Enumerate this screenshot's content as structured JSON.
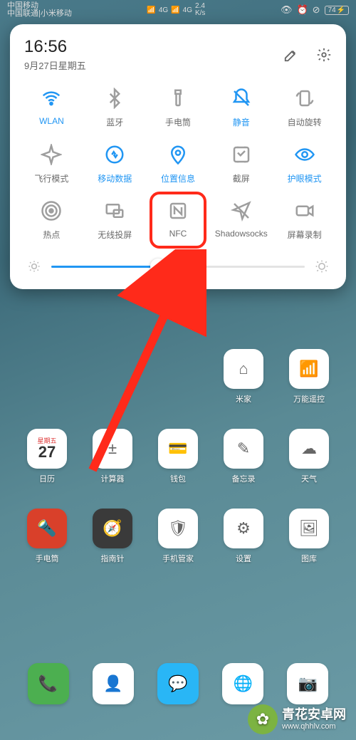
{
  "status": {
    "carrier1": "中国移动",
    "carrier2": "中国联通|小米移动",
    "net1": "4G",
    "net2": "4G",
    "speed": "2.4\nK/s",
    "battery": "74"
  },
  "panel": {
    "time": "16:56",
    "date": "9月27日星期五"
  },
  "tiles": [
    {
      "key": "wlan",
      "label": "WLAN",
      "state": "on"
    },
    {
      "key": "bluetooth",
      "label": "蓝牙",
      "state": "off"
    },
    {
      "key": "flashlight",
      "label": "手电筒",
      "state": "off"
    },
    {
      "key": "mute",
      "label": "静音",
      "state": "on"
    },
    {
      "key": "autorotate",
      "label": "自动旋转",
      "state": "off"
    },
    {
      "key": "airplane",
      "label": "飞行模式",
      "state": "off"
    },
    {
      "key": "data",
      "label": "移动数据",
      "state": "on"
    },
    {
      "key": "location",
      "label": "位置信息",
      "state": "on"
    },
    {
      "key": "screenshot",
      "label": "截屏",
      "state": "off"
    },
    {
      "key": "eyecare",
      "label": "护眼模式",
      "state": "on"
    },
    {
      "key": "hotspot",
      "label": "热点",
      "state": "off"
    },
    {
      "key": "cast",
      "label": "无线投屏",
      "state": "off"
    },
    {
      "key": "nfc",
      "label": "NFC",
      "state": "off",
      "highlight": true
    },
    {
      "key": "shadowsocks",
      "label": "Shadowsocks",
      "state": "off"
    },
    {
      "key": "record",
      "label": "屏幕录制",
      "state": "off"
    }
  ],
  "brightness": {
    "percent": 42
  },
  "home_apps": [
    {
      "label": "",
      "bg": "transparent"
    },
    {
      "label": "",
      "bg": "transparent"
    },
    {
      "label": "",
      "bg": "transparent"
    },
    {
      "label": "米家",
      "bg": "#ffffff",
      "glyph": "⌂"
    },
    {
      "label": "万能遥控",
      "bg": "#ffffff",
      "glyph": "📶"
    },
    {
      "label": "日历",
      "bg": "#ffffff",
      "glyph": "27",
      "subtext": "星期五"
    },
    {
      "label": "计算器",
      "bg": "#ffffff",
      "glyph": "±"
    },
    {
      "label": "钱包",
      "bg": "#ffffff",
      "glyph": "💳"
    },
    {
      "label": "备忘录",
      "bg": "#ffffff",
      "glyph": "✎"
    },
    {
      "label": "天气",
      "bg": "#ffffff",
      "glyph": "☁"
    },
    {
      "label": "手电筒",
      "bg": "#d9402a",
      "glyph": "🔦"
    },
    {
      "label": "指南针",
      "bg": "#3a3a3a",
      "glyph": "🧭"
    },
    {
      "label": "手机管家",
      "bg": "#ffffff",
      "glyph": "🛡"
    },
    {
      "label": "设置",
      "bg": "#ffffff",
      "glyph": "⚙"
    },
    {
      "label": "图库",
      "bg": "#ffffff",
      "glyph": "🖼"
    }
  ],
  "dock": [
    {
      "label": "",
      "bg": "#4caf50",
      "glyph": "📞"
    },
    {
      "label": "",
      "bg": "#ffffff",
      "glyph": "👤"
    },
    {
      "label": "",
      "bg": "#29b6f6",
      "glyph": "💬"
    },
    {
      "label": "",
      "bg": "#ffffff",
      "glyph": "🌐"
    },
    {
      "label": "",
      "bg": "#ffffff",
      "glyph": "📷"
    }
  ],
  "watermark": {
    "title": "青花安卓网",
    "url": "www.qhhlv.com"
  },
  "colors": {
    "accent": "#2196f3",
    "highlight": "#ff2a1a"
  }
}
